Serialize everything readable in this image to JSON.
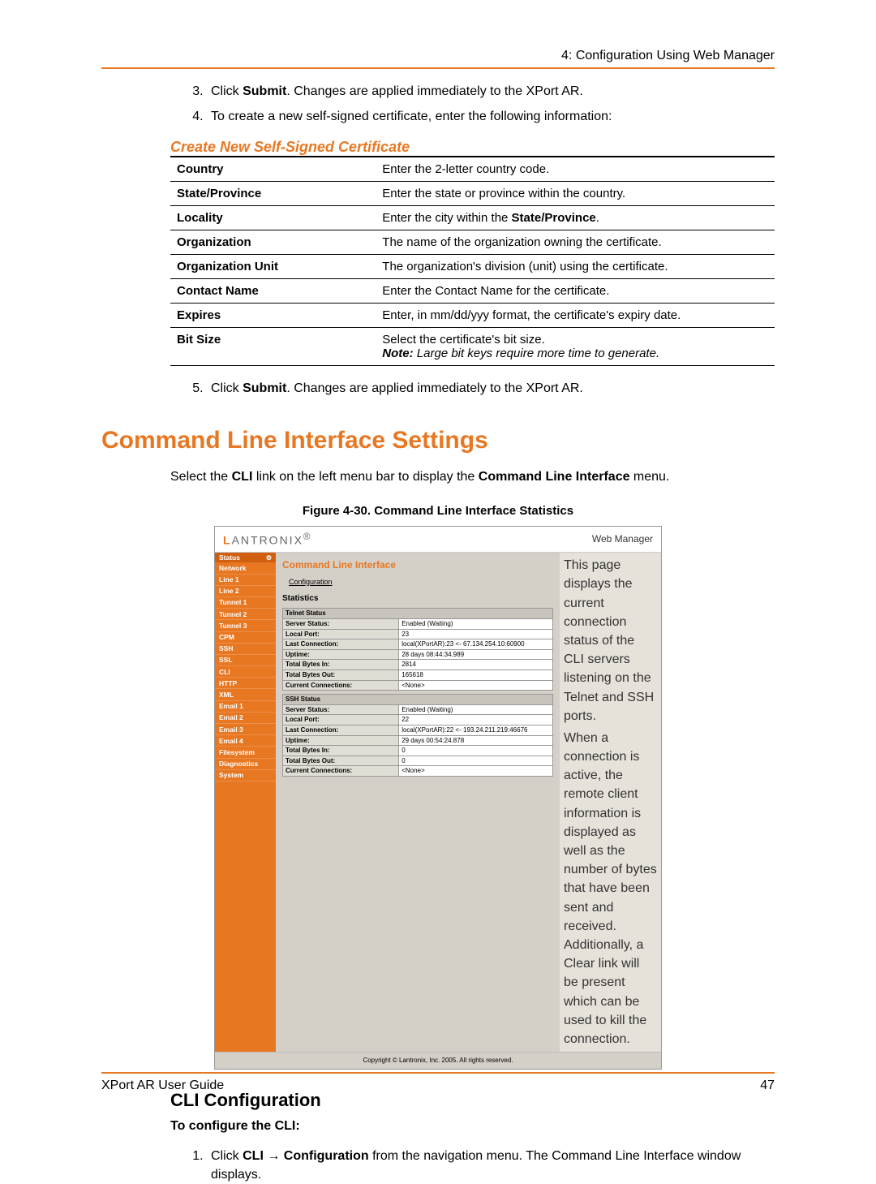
{
  "header": {
    "chapter": "4: Configuration Using Web Manager"
  },
  "steps_top": [
    {
      "n": "3.",
      "prefix": "Click ",
      "bold": "Submit",
      "suffix": ". Changes are applied immediately to the XPort AR."
    },
    {
      "n": "4.",
      "text": "To create a new self-signed certificate, enter the following information:"
    }
  ],
  "cert_heading": "Create New Self-Signed Certificate",
  "cert_table": [
    {
      "left": "Country",
      "right": "Enter the 2-letter country code."
    },
    {
      "left": "State/Province",
      "right": "Enter the state or province within the country."
    },
    {
      "left": "Locality",
      "right_pre": "Enter the city within the ",
      "right_bold": "State/Province",
      "right_post": "."
    },
    {
      "left": "Organization",
      "right": "The name of the organization owning the certificate."
    },
    {
      "left": "Organization Unit",
      "right": "The organization's division (unit) using the certificate."
    },
    {
      "left": "Contact Name",
      "right": "Enter the Contact Name for the certificate."
    },
    {
      "left": "Expires",
      "right": "Enter, in mm/dd/yyy format, the certificate's expiry date."
    },
    {
      "left": "Bit Size",
      "right": "Select the certificate's bit size.",
      "note_label": "Note:",
      "note": " Large bit keys require more time to generate."
    }
  ],
  "step5": {
    "n": "5.",
    "prefix": "Click ",
    "bold": "Submit",
    "suffix": ". Changes are applied immediately to the XPort AR."
  },
  "h1": "Command Line Interface Settings",
  "intro": {
    "pre": "Select the ",
    "b1": "CLI",
    "mid": " link on the left menu bar to display the ",
    "b2": "Command Line Interface",
    "post": " menu."
  },
  "figcap": "Figure 4-30. Command Line Interface Statistics",
  "screenshot": {
    "logo_l": "L",
    "logo_rest": "ANTRONIX",
    "header_right": "Web Manager",
    "sidebar_top": "Status",
    "sidebar": [
      "Network",
      "Line 1",
      "Line 2",
      "Tunnel 1",
      "Tunnel 2",
      "Tunnel 3",
      "CPM",
      "SSH",
      "SSL",
      "CLI",
      "HTTP",
      "XML",
      "Email 1",
      "Email 2",
      "Email 3",
      "Email 4",
      "Filesystem",
      "Diagnostics",
      "System"
    ],
    "title": "Command Line Interface",
    "conf_link": "Configuration",
    "stats_label": "Statistics",
    "telnet_head": "Telnet Status",
    "telnet": [
      [
        "Server Status:",
        "Enabled (Waiting)"
      ],
      [
        "Local Port:",
        "23"
      ],
      [
        "Last Connection:",
        "local(XPortAR):23 <- 67.134.254.10:60900"
      ],
      [
        "Uptime:",
        "28 days 08:44:34.989"
      ],
      [
        "Total Bytes In:",
        "2814"
      ],
      [
        "Total Bytes Out:",
        "165618"
      ],
      [
        "Current Connections:",
        "<None>"
      ]
    ],
    "ssh_head": "SSH Status",
    "ssh": [
      [
        "Server Status:",
        "Enabled (Waiting)"
      ],
      [
        "Local Port:",
        "22"
      ],
      [
        "Last Connection:",
        "local(XPortAR):22 <- 193.24.211.219:46676"
      ],
      [
        "Uptime:",
        "29 days 00:54:24.878"
      ],
      [
        "Total Bytes In:",
        "0"
      ],
      [
        "Total Bytes Out:",
        "0"
      ],
      [
        "Current Connections:",
        "<None>"
      ]
    ],
    "side_desc1": "This page displays the current connection status of the CLI servers listening on the Telnet and SSH ports.",
    "side_desc2": "When a connection is active, the remote client information is displayed as well as the number of bytes that have been sent and received. Additionally, a Clear link will be present which can be used to kill the connection.",
    "footer": "Copyright © Lantronix, Inc. 2005. All rights reserved."
  },
  "h2": "CLI Configuration",
  "h3": "To configure the CLI:",
  "step_cli": {
    "n": "1.",
    "pre": "Click ",
    "b1": "CLI",
    "arrow": " → ",
    "b2": "Configuration",
    "post": " from the navigation menu. The Command Line Interface window displays."
  },
  "footer": {
    "left": "XPort AR User Guide",
    "right": "47"
  }
}
